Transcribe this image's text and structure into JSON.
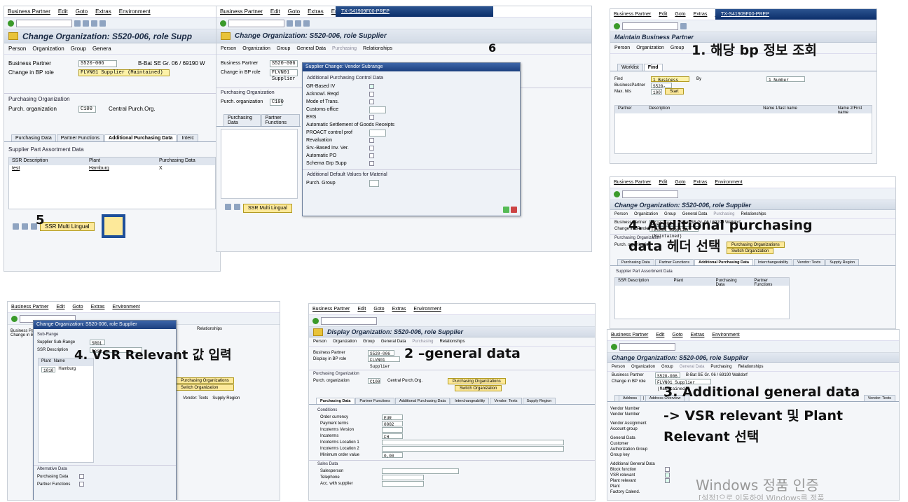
{
  "menu": [
    "Business Partner",
    "Edit",
    "Goto",
    "Extras",
    "Environment"
  ],
  "s1": {
    "title": "Maintain Business Partner",
    "sub_tabs": [
      "Worklist",
      "Find"
    ],
    "bar": [
      "Person",
      "Organization",
      "Group"
    ],
    "find_lbl": "Find",
    "find_val": "1 Business Partner",
    "by": "By",
    "by_val": "1 Number",
    "bp_lbl": "BusinessPartner",
    "bp_val": "S520-006",
    "max_lbl": "Max. hits",
    "max_val": "100",
    "start": "Start",
    "cols": [
      "Partner",
      "Description",
      "Name 1/last name",
      "Name 2/First name"
    ],
    "anno": "1. 해당 bp 정보 조회",
    "window": "TX-S41909F00-PREP"
  },
  "s2": {
    "title": "Display Organization: S520-006, role Supplier",
    "bar": [
      "Person",
      "Organization",
      "Group",
      "General Data",
      "Purchasing",
      "Relationships"
    ],
    "bp_lbl": "Business Partner",
    "bp_val": "S520-006",
    "bp_txt": "B-Bat SE Gr. 06 / 69190 Walldorf",
    "role_lbl": "Display in BP role",
    "role_val": "FLVN01 Supplier",
    "po_sec": "Purchasing Organization",
    "po_lbl": "Purch. organization",
    "po_val": "C100",
    "po_txt": "Central Purch.Org.",
    "btn1": "Purchasing Organizations",
    "btn2": "Switch Organization",
    "tabs": [
      "Purchasing Data",
      "Partner Functions",
      "Additional Purchasing Data",
      "Interchangeability",
      "Vendor: Texts",
      "Supply Region"
    ],
    "cond_sec": "Conditions",
    "cond": [
      [
        "Order currency",
        "EUR"
      ],
      [
        "Payment terms",
        "0002"
      ],
      [
        "Incoterms Version",
        ""
      ],
      [
        "Incoterms",
        "FH"
      ],
      [
        "Incoterms Location 1",
        ""
      ],
      [
        "Incoterms Location 2",
        ""
      ],
      [
        "Minimum order value",
        "0,00"
      ]
    ],
    "sales_sec": "Sales Data",
    "sales": [
      "Salesperson",
      "Telephone",
      "Acc. with supplier"
    ],
    "anno": "2 –general data"
  },
  "s3": {
    "title": "Change Organization: S520-006, role Supplier",
    "bar": [
      "Person",
      "Organization",
      "Group",
      "General Data",
      "Purchasing",
      "Relationships"
    ],
    "bp_lbl": "Business Partner",
    "bp_val": "S520-006",
    "bp_txt": "B-Bat SE Gr. 06 / 69190 Walldorf",
    "role_lbl": "Change in BP role",
    "role_val": "FLVN01 Supplier (Maintained)",
    "tabs": [
      "Address",
      "Address Overview",
      "Vendor: Texts"
    ],
    "sec1": "Vendor Number",
    "r1": "Vendor Number",
    "sec2": "Vendor Assignment",
    "r2": "Account group",
    "sec3": "General Data",
    "r3": [
      "Customer",
      "Authorization Group",
      "Group key"
    ],
    "sec4": "Additional General Data",
    "r4": [
      "Block function",
      "VSR relevant",
      "Plant relevant",
      "Plant",
      "Factory Calend."
    ],
    "anno1": "3. Additional general data",
    "anno2": "-> VSR relevant 및 Plant",
    "anno3": "Relevant 선택",
    "wm1": "Windows 정품 인증",
    "wm2": "[설정]으로 이동하여 Windows를 정품"
  },
  "s4": {
    "title": "Change Organization: S520-006, role Supplier",
    "bar": [
      "Person",
      "Organization",
      "Group",
      "General Data",
      "Purchasing",
      "Relationships"
    ],
    "bp_lbl": "Business Partner",
    "bp_val": "S520-006",
    "bp_txt": "B-Bat SE Gr. 06 / 69190 Walldorf",
    "role_lbl": "Change in BP role",
    "role_val": "FLVN01 Supplier (Maintained)",
    "po_sec": "Purchasing Organization",
    "po_lbl": "Purch. organization",
    "btn1": "Purchasing Organizations",
    "btn2": "Switch Organization",
    "tabs": [
      "Purchasing Data",
      "Partner Functions",
      "Additional Purchasing Data",
      "Interchangeability",
      "Vendor: Texts",
      "Supply Region"
    ],
    "grid_sec": "Supplier Part Assortment Data",
    "cols": [
      "SSR Description",
      "Plant",
      "Purchasing Data",
      "Partner Functions"
    ],
    "anno1": "4. Additional purchasing",
    "anno2": "data 헤더 선택"
  },
  "s5": {
    "title": "Change Organization: S520-006, role Supp",
    "bar": [
      "Person",
      "Organization",
      "Group",
      "Genera"
    ],
    "bp_lbl": "Business Partner",
    "bp_val": "S520-006",
    "bp_txt": "B-Bat SE Gr. 06 / 69190 W",
    "role_lbl": "Change in BP role",
    "role_val": "FLVN01 Supplier (Maintained)",
    "po_sec": "Purchasing Organization",
    "po_lbl": "Purch. organization",
    "po_val": "C100",
    "po_txt": "Central Purch.Org.",
    "tabs": [
      "Purchasing Data",
      "Partner Functions",
      "Additional Purchasing Data",
      "Interc"
    ],
    "grid_sec": "Supplier Part Assortment Data",
    "cols": [
      "SSR Description",
      "Plant",
      "Purchasing Data"
    ],
    "row": [
      "test",
      "Hamburg",
      "X"
    ],
    "btn": "SSR Multi Lingual",
    "anno": "5"
  },
  "s6": {
    "title": "Change Organization: S520-006, role Supplier",
    "bar": [
      "Person",
      "Organization",
      "Group",
      "General Data",
      "Purchasing",
      "Relationships"
    ],
    "bp_lbl": "Business Partner",
    "bp_val": "S520-006",
    "role_lbl": "Change in BP role",
    "role_val": "FLVN01 Supplier",
    "po_sec": "Purchasing Organization",
    "po_lbl": "Purch. organization",
    "po_val": "C100",
    "tabs": [
      "Purchasing Data",
      "Partner Functions"
    ],
    "btn": "SSR Multi Lingual",
    "dlg_title": "Supplier Change: Vendor Subrange",
    "dlg_sec1": "Additional Purchasing Control Data",
    "dlg_rows": [
      "GR-Based IV",
      "Acknowl. Reqd",
      "Mode of Trans.",
      "Customs office",
      "ERS",
      "Automatic Settlement of Goods Receipts",
      "PROACT control prof",
      "Revaluation",
      "Srv.-Based Inv. Ver.",
      "Automatic PO",
      "Schema Grp Supp"
    ],
    "dlg_sec2": "Additional Default Values for Material",
    "dlg_row2": "Purch. Group",
    "anno": "6",
    "window": "TX-S41909F00-PREP"
  },
  "s7": {
    "dlg_title": "Change Organization: S520-006, role Supplier",
    "sub": "Sub-Range",
    "r1": "Supplier Sub-Range",
    "v1": "SR01",
    "r2": "SSR Description",
    "v2": "test",
    "cols": [
      "Plant",
      "Name"
    ],
    "plant": "1010",
    "name": "Hamburg",
    "alt_sec": "Alternative Data",
    "alt": [
      "Purchasing Data",
      "Partner Functions"
    ],
    "bp_lbl": "Business Par",
    "role_lbl": "Change in B",
    "bar": [
      "Relationships"
    ],
    "btn1": "Purchasing Organizations",
    "btn2": "Switch Organization",
    "tabs": [
      "Vendor: Texts",
      "Supply Region"
    ],
    "anno": "4. VSR Relevant 값 입력"
  }
}
